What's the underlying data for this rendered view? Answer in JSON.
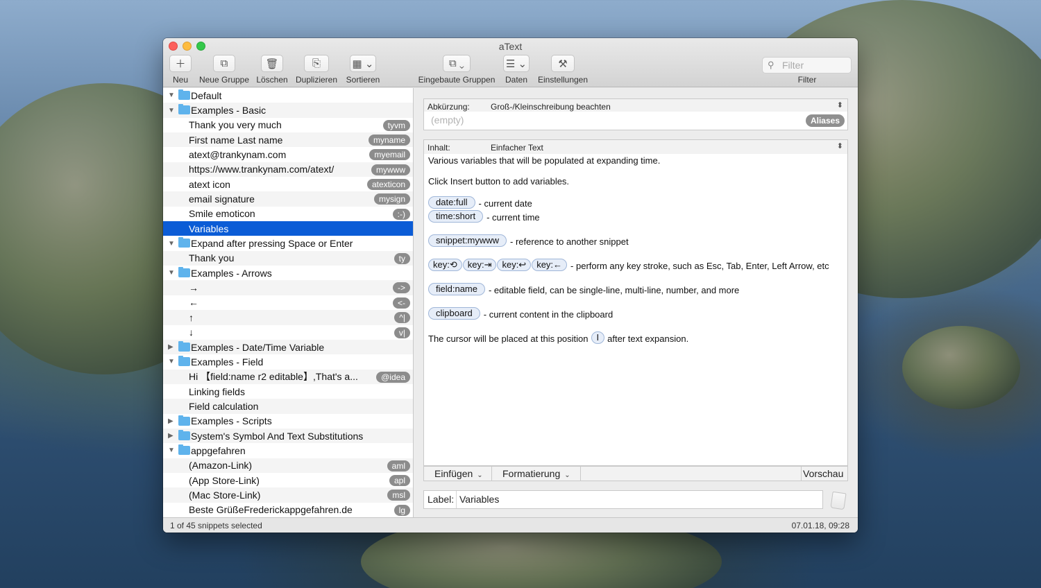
{
  "window": {
    "title": "aText"
  },
  "toolbar": {
    "buttons": [
      {
        "label": "Neu",
        "icon": "plus-icon",
        "glyph": "＋"
      },
      {
        "label": "Neue Gruppe",
        "icon": "new-group-icon",
        "glyph": "⧉"
      },
      {
        "label": "Löschen",
        "icon": "trash-icon",
        "glyph": "🗑"
      },
      {
        "label": "Duplizieren",
        "icon": "duplicate-icon",
        "glyph": "⎘"
      },
      {
        "label": "Sortieren",
        "icon": "sort-icon",
        "glyph": "▦ ⌄"
      },
      {
        "label": "Eingebaute Gruppen",
        "icon": "builtin-groups-icon",
        "glyph": "⧉ ⌄"
      },
      {
        "label": "Daten",
        "icon": "data-icon",
        "glyph": "☰ ⌄"
      },
      {
        "label": "Einstellungen",
        "icon": "tools-icon",
        "glyph": "⚒"
      }
    ],
    "filter": {
      "placeholder": "Filter",
      "label": "Filter"
    }
  },
  "sidebar": {
    "rows": [
      {
        "type": "group",
        "text": "Default",
        "disc": "▼"
      },
      {
        "type": "group",
        "text": "Examples - Basic",
        "disc": "▼"
      },
      {
        "type": "item",
        "text": "Thank you very much",
        "abbr": "tyvm"
      },
      {
        "type": "item",
        "text": "First name Last name",
        "abbr": "myname"
      },
      {
        "type": "item",
        "text": "atext@trankynam.com",
        "abbr": "myemail"
      },
      {
        "type": "item",
        "text": "https://www.trankynam.com/atext/",
        "abbr": "mywww"
      },
      {
        "type": "item",
        "text": "atext icon",
        "abbr": "atexticon"
      },
      {
        "type": "item",
        "text": "email signature",
        "abbr": "mysign"
      },
      {
        "type": "item",
        "text": "Smile emoticon",
        "abbr": ":-)"
      },
      {
        "type": "item",
        "text": "Variables",
        "abbr": "",
        "selected": true
      },
      {
        "type": "group",
        "text": "Expand after pressing Space or Enter",
        "disc": "▼"
      },
      {
        "type": "item",
        "text": "Thank you",
        "abbr": "ty"
      },
      {
        "type": "group",
        "text": "Examples - Arrows",
        "disc": "▼"
      },
      {
        "type": "item",
        "text": "→",
        "abbr": "->"
      },
      {
        "type": "item",
        "text": "←",
        "abbr": "<-"
      },
      {
        "type": "item",
        "text": "↑",
        "abbr": "^|"
      },
      {
        "type": "item",
        "text": "↓",
        "abbr": "v|"
      },
      {
        "type": "group",
        "text": "Examples - Date/Time Variable",
        "disc": "▶"
      },
      {
        "type": "group",
        "text": "Examples - Field",
        "disc": "▼"
      },
      {
        "type": "item",
        "text": "Hi 【field:name r2 editable】,That's a...",
        "abbr": "@idea"
      },
      {
        "type": "item",
        "text": "Linking fields",
        "abbr": ""
      },
      {
        "type": "item",
        "text": "Field calculation",
        "abbr": ""
      },
      {
        "type": "group",
        "text": "Examples - Scripts",
        "disc": "▶"
      },
      {
        "type": "group",
        "text": "System's Symbol And Text Substitutions",
        "disc": "▶"
      },
      {
        "type": "group",
        "text": "appgefahren",
        "disc": "▼"
      },
      {
        "type": "item",
        "text": "(Amazon-Link)",
        "abbr": "aml"
      },
      {
        "type": "item",
        "text": "(App Store-Link)",
        "abbr": "apl"
      },
      {
        "type": "item",
        "text": "(Mac Store-Link)",
        "abbr": "msl"
      },
      {
        "type": "item",
        "text": "Beste GrüßeFrederickappgefahren.de",
        "abbr": "lg"
      }
    ]
  },
  "status": {
    "left": "1 of 45 snippets selected",
    "right": "07.01.18, 09:28"
  },
  "editor": {
    "abbreviation": {
      "key": "Abkürzung:",
      "value": "Groß-/Kleinschreibung beachten",
      "placeholder": "(empty)",
      "aliases": "Aliases"
    },
    "content": {
      "key": "Inhalt:",
      "value": "Einfacher Text"
    },
    "lines": {
      "intro1": "Various variables that will be populated at expanding time.",
      "intro2": "Click Insert button to add variables.",
      "date_pill": "date:full",
      "date_desc": "- current date",
      "time_pill": "time:short",
      "time_desc": "- current time",
      "snippet_pill": "snippet:mywww",
      "snippet_desc": "- reference to another snippet",
      "key1": "key:⟲",
      "key2": "key:⇥",
      "key3": "key:↩",
      "key4": "key:←",
      "key_desc": "- perform any key stroke, such as Esc, Tab, Enter, Left Arrow, etc",
      "field_pill": "field:name",
      "field_desc": "- editable field, can be single-line, multi-line, number, and more",
      "clip_pill": "clipboard",
      "clip_desc": "- current content in the clipboard",
      "cursor_pre": "The cursor will be placed at this position",
      "cursor_pill": "I",
      "cursor_post": "after text expansion."
    },
    "bar": {
      "insert": "Einfügen",
      "format": "Formatierung",
      "preview": "Vorschau"
    },
    "label": {
      "key": "Label:",
      "value": "Variables"
    }
  }
}
